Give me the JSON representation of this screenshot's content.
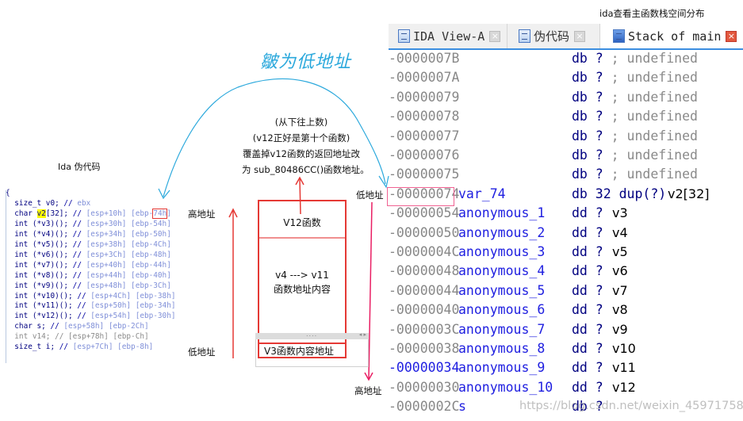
{
  "annotations": {
    "handwritten_note": "皺为低地址",
    "ida_pseudocode_title": "Ida 伪代码",
    "ida_stack_caption": "ida查看主函数栈空间分布",
    "explanation_lines": [
      "(从下往上数)",
      "(v12正好是第十个函数)",
      "覆盖掉v12函数的返回地址改",
      "为 sub_80486CC()函数地址。"
    ],
    "left_high_addr": "高地址",
    "left_low_addr": "低地址",
    "right_low_addr": "低地址",
    "right_high_addr": "高地址"
  },
  "diagram": {
    "v12_block": "V12函数",
    "middle_block_line1": "v4 ---> v11",
    "middle_block_line2": "函数地址内容",
    "v3_block": "V3函数内容地址",
    "scroll_dots": "....",
    "scroll_arrows": "◂ ▸"
  },
  "pseudocode": {
    "open_brace": "{",
    "lines": [
      {
        "decl": "  size_t v0; ",
        "slash": "// ",
        "comment": "ebx"
      },
      {
        "pre": "  char ",
        "hl": "v2",
        "post": "[32]; ",
        "slash": "// ",
        "comment": "[esp+10h] [ebp-",
        "boxed": "74h",
        "tail": ""
      },
      {
        "decl": "  int (*v3)(); ",
        "slash": "// ",
        "comment": "[esp+30h] [ebp-54h]"
      },
      {
        "decl": "  int (*v4)(); ",
        "slash": "// ",
        "comment": "[esp+34h] [ebp-50h]"
      },
      {
        "decl": "  int (*v5)(); ",
        "slash": "// ",
        "comment": "[esp+38h] [ebp-4Ch]"
      },
      {
        "decl": "  int (*v6)(); ",
        "slash": "// ",
        "comment": "[esp+3Ch] [ebp-48h]"
      },
      {
        "decl": "  int (*v7)(); ",
        "slash": "// ",
        "comment": "[esp+40h] [ebp-44h]"
      },
      {
        "decl": "  int (*v8)(); ",
        "slash": "// ",
        "comment": "[esp+44h] [ebp-40h]"
      },
      {
        "decl": "  int (*v9)(); ",
        "slash": "// ",
        "comment": "[esp+48h] [ebp-3Ch]"
      },
      {
        "decl": "  int (*v10)(); ",
        "slash": "// ",
        "comment": "[esp+4Ch] [ebp-38h]"
      },
      {
        "decl": "  int (*v11)(); ",
        "slash": "// ",
        "comment": "[esp+50h] [ebp-34h]"
      },
      {
        "decl": "  int (*v12)(); ",
        "slash": "// ",
        "comment": "[esp+54h] [ebp-30h]"
      },
      {
        "decl": "  char s; ",
        "slash": "// ",
        "comment": "[esp+58h] [ebp-2Ch]"
      },
      {
        "decl": "  int v14; ",
        "slash": "// ",
        "comment": "[esp+78h] [ebp-Ch]",
        "grey": true
      },
      {
        "decl": "  size_t i; ",
        "slash": "// ",
        "comment": "[esp+7Ch] [ebp-8h]"
      }
    ]
  },
  "ida": {
    "tabs": [
      {
        "label": "IDA View-A",
        "icon": "ida-view-icon",
        "active": false
      },
      {
        "label": "伪代码",
        "icon": "pseudocode-icon",
        "active": false
      },
      {
        "label": "Stack of main",
        "icon": "stack-icon",
        "active": true
      }
    ],
    "close_glyph": "×",
    "rows": [
      {
        "addr": "-0000007B",
        "name": "",
        "type": "db",
        "q": " ?",
        "comment": " ; undefined",
        "note": ""
      },
      {
        "addr": "-0000007A",
        "name": "",
        "type": "db",
        "q": " ?",
        "comment": " ; undefined",
        "note": ""
      },
      {
        "addr": "-00000079",
        "name": "",
        "type": "db",
        "q": " ?",
        "comment": " ; undefined",
        "note": ""
      },
      {
        "addr": "-00000078",
        "name": "",
        "type": "db",
        "q": " ?",
        "comment": " ; undefined",
        "note": ""
      },
      {
        "addr": "-00000077",
        "name": "",
        "type": "db",
        "q": " ?",
        "comment": " ; undefined",
        "note": ""
      },
      {
        "addr": "-00000076",
        "name": "",
        "type": "db",
        "q": " ?",
        "comment": " ; undefined",
        "note": ""
      },
      {
        "addr": "-00000075",
        "name": "",
        "type": "db",
        "q": " ?",
        "comment": " ; undefined",
        "note": ""
      },
      {
        "addr": "-00000074",
        "name": "var_74",
        "type": "db",
        "q": " 32 dup(?)",
        "comment": "",
        "note": "v2[32]"
      },
      {
        "addr": "-00000054",
        "name": "anonymous_1",
        "type": "dd",
        "q": " ?",
        "comment": "",
        "note": "v3"
      },
      {
        "addr": "-00000050",
        "name": "anonymous_2",
        "type": "dd",
        "q": " ?",
        "comment": "",
        "note": "v4"
      },
      {
        "addr": "-0000004C",
        "name": "anonymous_3",
        "type": "dd",
        "q": " ?",
        "comment": "",
        "note": "v5"
      },
      {
        "addr": "-00000048",
        "name": "anonymous_4",
        "type": "dd",
        "q": " ?",
        "comment": "",
        "note": "v6"
      },
      {
        "addr": "-00000044",
        "name": "anonymous_5",
        "type": "dd",
        "q": " ?",
        "comment": "",
        "note": "v7"
      },
      {
        "addr": "-00000040",
        "name": "anonymous_6",
        "type": "dd",
        "q": " ?",
        "comment": "",
        "note": "v8"
      },
      {
        "addr": "-0000003C",
        "name": "anonymous_7",
        "type": "dd",
        "q": " ?",
        "comment": "",
        "note": "v9"
      },
      {
        "addr": "-00000038",
        "name": "anonymous_8",
        "type": "dd",
        "q": " ?",
        "comment": "",
        "note": "v10"
      },
      {
        "addr": "-00000034",
        "name": "anonymous_9",
        "type": "dd",
        "q": " ?",
        "comment": "",
        "note": "v11",
        "addr_blue": true
      },
      {
        "addr": "-00000030",
        "name": "anonymous_10",
        "type": "dd",
        "q": " ?",
        "comment": "",
        "note": "v12"
      },
      {
        "addr": "-0000002C",
        "name": "s",
        "type": "db",
        "q": " ?",
        "comment": "",
        "note": ""
      }
    ]
  },
  "colors": {
    "red_box": "#e53935",
    "pink_arrow": "#e91e63",
    "hand_blue": "#2aa8dc",
    "ida_blue": "#1f1fe0",
    "ida_navy": "#000080",
    "addr_grey": "#888888"
  },
  "watermark": "https://blog.csdn.net/weixin_45971758"
}
